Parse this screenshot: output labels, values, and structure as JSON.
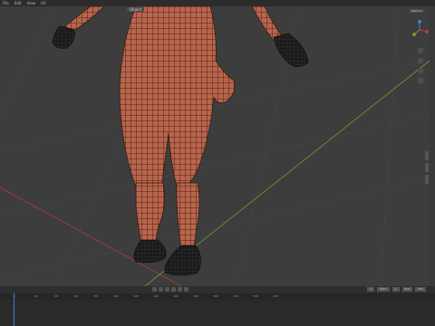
{
  "menu": [
    "File",
    "Edit",
    "View",
    "UV"
  ],
  "viewport": {
    "mode_label": "Object",
    "options_label": "Options"
  },
  "timeline": {
    "ruler_ticks": [
      "0",
      "20",
      "40",
      "60",
      "80",
      "100",
      "120",
      "140",
      "160",
      "180",
      "200",
      "220",
      "240",
      "260"
    ],
    "current_frame": "1",
    "start_label": "Start",
    "start_value": "1",
    "end_label": "End",
    "end_value": "250"
  },
  "colors": {
    "skin": "#b5634a",
    "mesh_line": "#2a1410",
    "axis_x": "#c03a3a",
    "axis_y": "#7a9a30"
  }
}
